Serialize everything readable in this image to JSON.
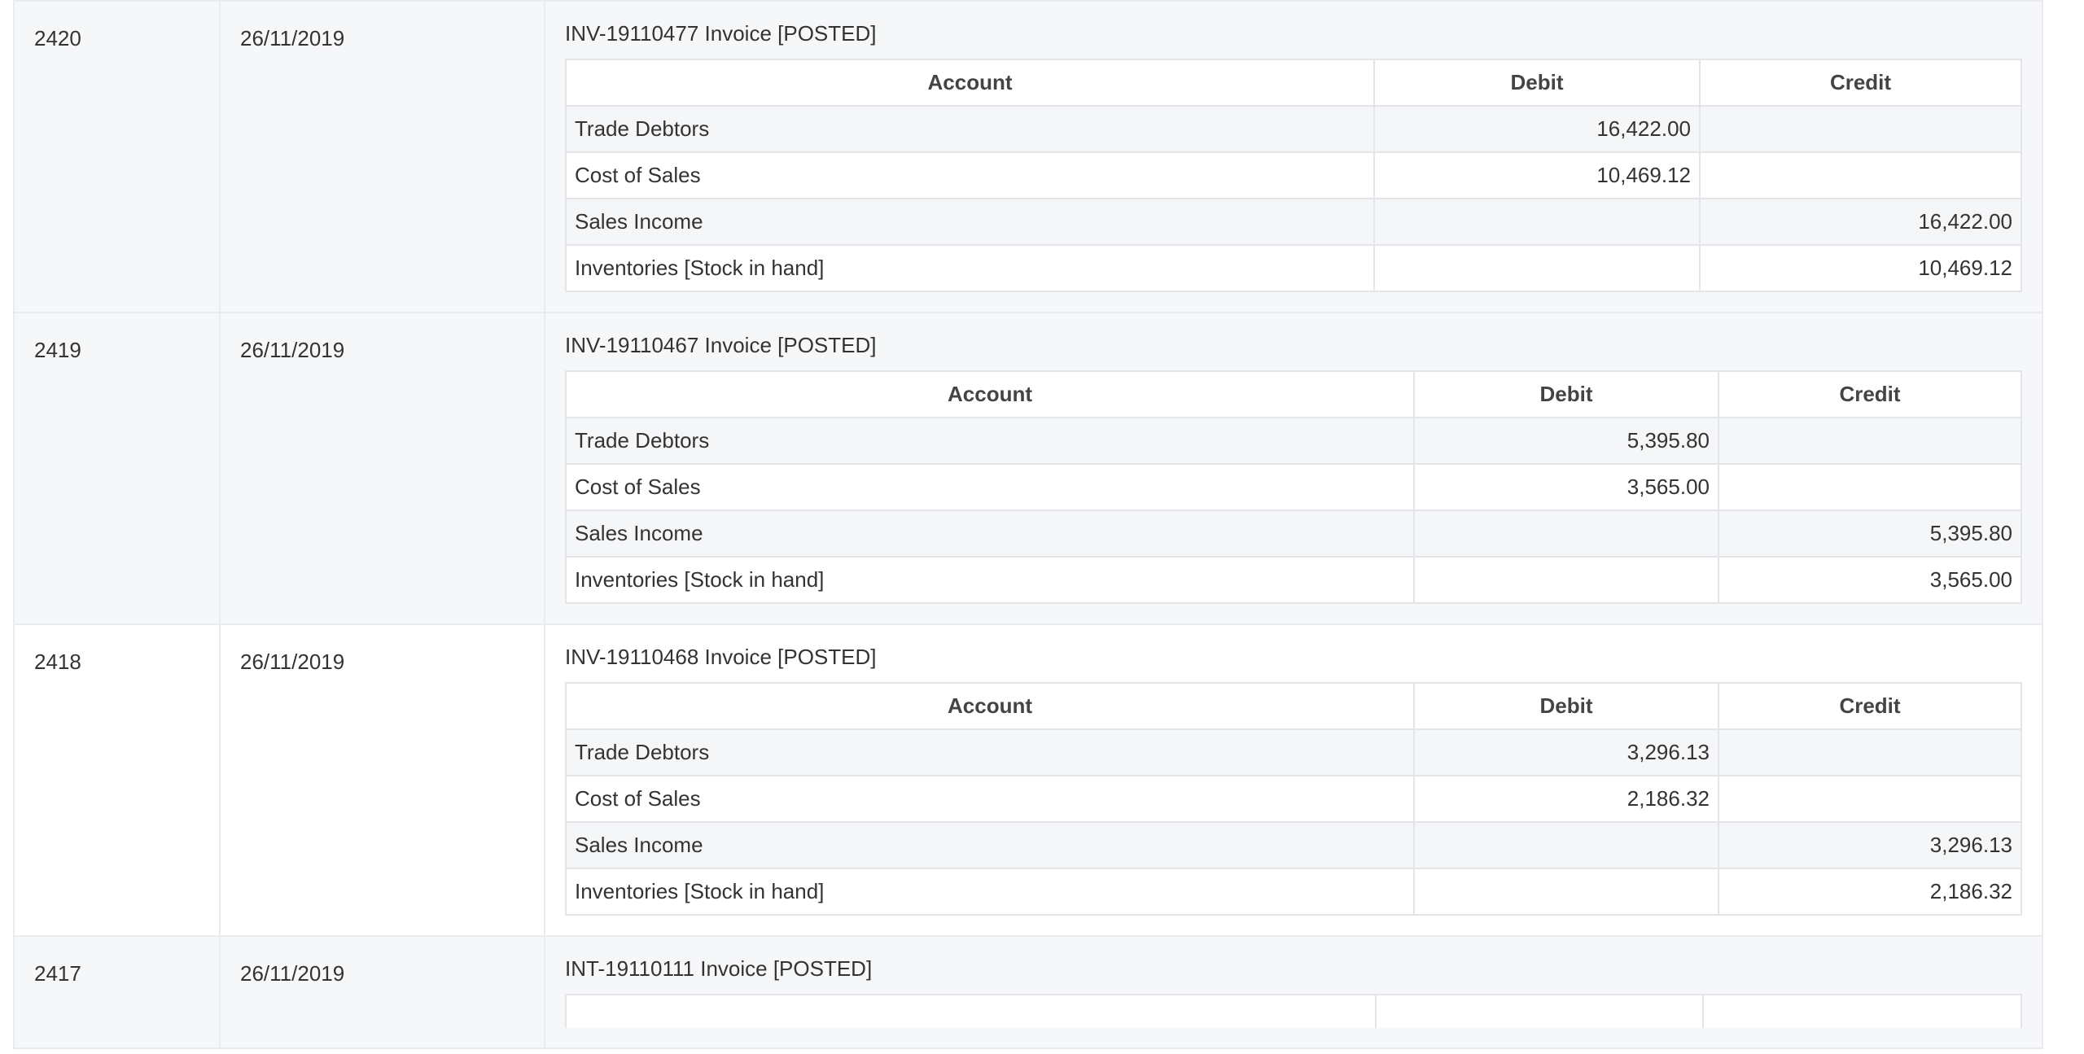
{
  "columns": [
    "Account",
    "Debit",
    "Credit"
  ],
  "entries": [
    {
      "id": "2420",
      "date": "26/11/2019",
      "title": "INV-19110477 Invoice [POSTED]",
      "lines": [
        {
          "account": "Trade Debtors",
          "debit": "16,422.00",
          "credit": ""
        },
        {
          "account": "Cost of Sales",
          "debit": "10,469.12",
          "credit": ""
        },
        {
          "account": "Sales Income",
          "debit": "",
          "credit": "16,422.00"
        },
        {
          "account": "Inventories [Stock in hand]",
          "debit": "",
          "credit": "10,469.12"
        }
      ]
    },
    {
      "id": "2419",
      "date": "26/11/2019",
      "title": "INV-19110467 Invoice [POSTED]",
      "lines": [
        {
          "account": "Trade Debtors",
          "debit": "5,395.80",
          "credit": ""
        },
        {
          "account": "Cost of Sales",
          "debit": "3,565.00",
          "credit": ""
        },
        {
          "account": "Sales Income",
          "debit": "",
          "credit": "5,395.80"
        },
        {
          "account": "Inventories [Stock in hand]",
          "debit": "",
          "credit": "3,565.00"
        }
      ]
    },
    {
      "id": "2418",
      "date": "26/11/2019",
      "title": "INV-19110468 Invoice [POSTED]",
      "lines": [
        {
          "account": "Trade Debtors",
          "debit": "3,296.13",
          "credit": ""
        },
        {
          "account": "Cost of Sales",
          "debit": "2,186.32",
          "credit": ""
        },
        {
          "account": "Sales Income",
          "debit": "",
          "credit": "3,296.13"
        },
        {
          "account": "Inventories [Stock in hand]",
          "debit": "",
          "credit": "2,186.32"
        }
      ]
    },
    {
      "id": "2417",
      "date": "26/11/2019",
      "title": "INT-19110111 Invoice [POSTED]",
      "lines": []
    }
  ]
}
